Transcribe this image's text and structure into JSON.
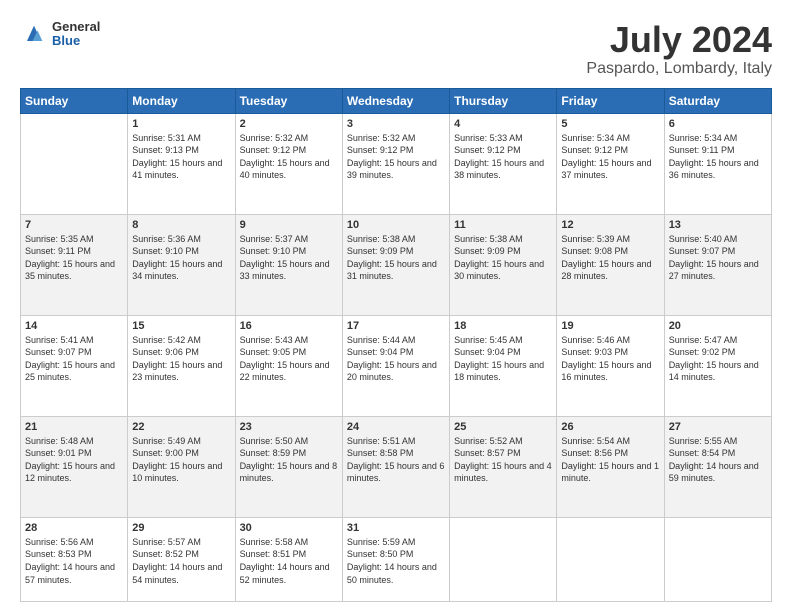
{
  "app": {
    "logo_general": "General",
    "logo_blue": "Blue",
    "title": "July 2024",
    "location": "Paspardo, Lombardy, Italy"
  },
  "calendar": {
    "headers": [
      "Sunday",
      "Monday",
      "Tuesday",
      "Wednesday",
      "Thursday",
      "Friday",
      "Saturday"
    ],
    "rows": [
      {
        "shaded": false,
        "cells": [
          {
            "day": "",
            "empty": true
          },
          {
            "day": "1",
            "sunrise": "5:31 AM",
            "sunset": "9:13 PM",
            "daylight": "15 hours and 41 minutes."
          },
          {
            "day": "2",
            "sunrise": "5:32 AM",
            "sunset": "9:12 PM",
            "daylight": "15 hours and 40 minutes."
          },
          {
            "day": "3",
            "sunrise": "5:32 AM",
            "sunset": "9:12 PM",
            "daylight": "15 hours and 39 minutes."
          },
          {
            "day": "4",
            "sunrise": "5:33 AM",
            "sunset": "9:12 PM",
            "daylight": "15 hours and 38 minutes."
          },
          {
            "day": "5",
            "sunrise": "5:34 AM",
            "sunset": "9:12 PM",
            "daylight": "15 hours and 37 minutes."
          },
          {
            "day": "6",
            "sunrise": "5:34 AM",
            "sunset": "9:11 PM",
            "daylight": "15 hours and 36 minutes."
          }
        ]
      },
      {
        "shaded": true,
        "cells": [
          {
            "day": "7",
            "sunrise": "5:35 AM",
            "sunset": "9:11 PM",
            "daylight": "15 hours and 35 minutes."
          },
          {
            "day": "8",
            "sunrise": "5:36 AM",
            "sunset": "9:10 PM",
            "daylight": "15 hours and 34 minutes."
          },
          {
            "day": "9",
            "sunrise": "5:37 AM",
            "sunset": "9:10 PM",
            "daylight": "15 hours and 33 minutes."
          },
          {
            "day": "10",
            "sunrise": "5:38 AM",
            "sunset": "9:09 PM",
            "daylight": "15 hours and 31 minutes."
          },
          {
            "day": "11",
            "sunrise": "5:38 AM",
            "sunset": "9:09 PM",
            "daylight": "15 hours and 30 minutes."
          },
          {
            "day": "12",
            "sunrise": "5:39 AM",
            "sunset": "9:08 PM",
            "daylight": "15 hours and 28 minutes."
          },
          {
            "day": "13",
            "sunrise": "5:40 AM",
            "sunset": "9:07 PM",
            "daylight": "15 hours and 27 minutes."
          }
        ]
      },
      {
        "shaded": false,
        "cells": [
          {
            "day": "14",
            "sunrise": "5:41 AM",
            "sunset": "9:07 PM",
            "daylight": "15 hours and 25 minutes."
          },
          {
            "day": "15",
            "sunrise": "5:42 AM",
            "sunset": "9:06 PM",
            "daylight": "15 hours and 23 minutes."
          },
          {
            "day": "16",
            "sunrise": "5:43 AM",
            "sunset": "9:05 PM",
            "daylight": "15 hours and 22 minutes."
          },
          {
            "day": "17",
            "sunrise": "5:44 AM",
            "sunset": "9:04 PM",
            "daylight": "15 hours and 20 minutes."
          },
          {
            "day": "18",
            "sunrise": "5:45 AM",
            "sunset": "9:04 PM",
            "daylight": "15 hours and 18 minutes."
          },
          {
            "day": "19",
            "sunrise": "5:46 AM",
            "sunset": "9:03 PM",
            "daylight": "15 hours and 16 minutes."
          },
          {
            "day": "20",
            "sunrise": "5:47 AM",
            "sunset": "9:02 PM",
            "daylight": "15 hours and 14 minutes."
          }
        ]
      },
      {
        "shaded": true,
        "cells": [
          {
            "day": "21",
            "sunrise": "5:48 AM",
            "sunset": "9:01 PM",
            "daylight": "15 hours and 12 minutes."
          },
          {
            "day": "22",
            "sunrise": "5:49 AM",
            "sunset": "9:00 PM",
            "daylight": "15 hours and 10 minutes."
          },
          {
            "day": "23",
            "sunrise": "5:50 AM",
            "sunset": "8:59 PM",
            "daylight": "15 hours and 8 minutes."
          },
          {
            "day": "24",
            "sunrise": "5:51 AM",
            "sunset": "8:58 PM",
            "daylight": "15 hours and 6 minutes."
          },
          {
            "day": "25",
            "sunrise": "5:52 AM",
            "sunset": "8:57 PM",
            "daylight": "15 hours and 4 minutes."
          },
          {
            "day": "26",
            "sunrise": "5:54 AM",
            "sunset": "8:56 PM",
            "daylight": "15 hours and 1 minute."
          },
          {
            "day": "27",
            "sunrise": "5:55 AM",
            "sunset": "8:54 PM",
            "daylight": "14 hours and 59 minutes."
          }
        ]
      },
      {
        "shaded": false,
        "cells": [
          {
            "day": "28",
            "sunrise": "5:56 AM",
            "sunset": "8:53 PM",
            "daylight": "14 hours and 57 minutes."
          },
          {
            "day": "29",
            "sunrise": "5:57 AM",
            "sunset": "8:52 PM",
            "daylight": "14 hours and 54 minutes."
          },
          {
            "day": "30",
            "sunrise": "5:58 AM",
            "sunset": "8:51 PM",
            "daylight": "14 hours and 52 minutes."
          },
          {
            "day": "31",
            "sunrise": "5:59 AM",
            "sunset": "8:50 PM",
            "daylight": "14 hours and 50 minutes."
          },
          {
            "day": "",
            "empty": true
          },
          {
            "day": "",
            "empty": true
          },
          {
            "day": "",
            "empty": true
          }
        ]
      }
    ]
  }
}
